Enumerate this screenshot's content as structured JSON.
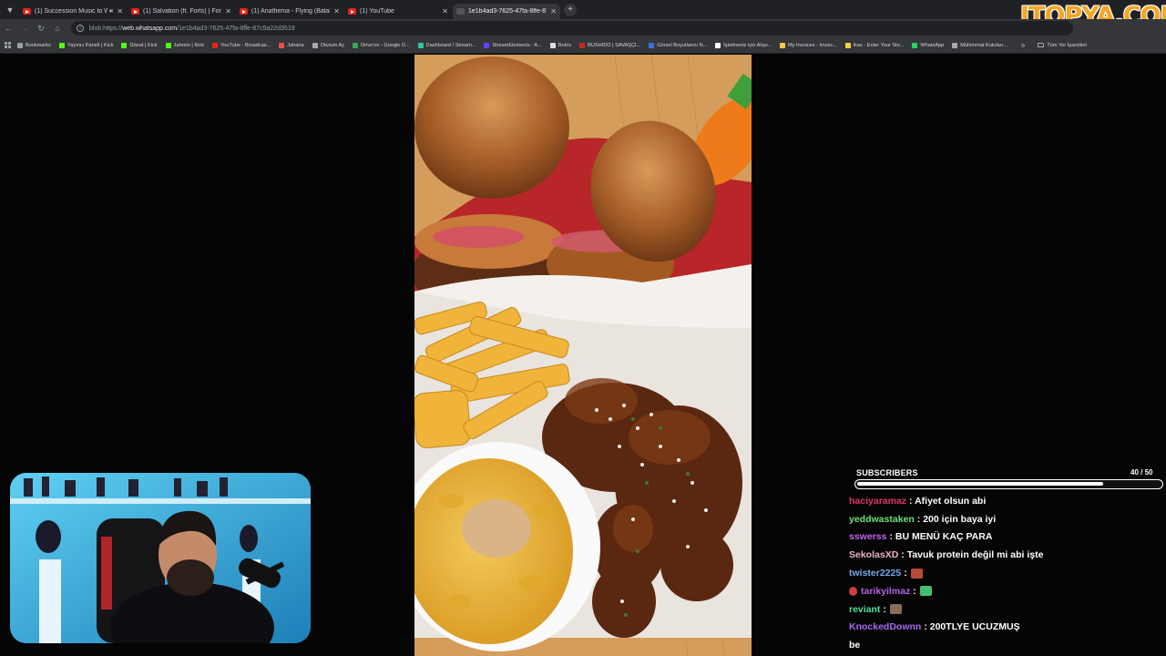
{
  "browser": {
    "tabs": [
      {
        "title": "(1) Succession Music to W",
        "favicon": "youtube-icon",
        "playing": true,
        "active": false
      },
      {
        "title": "(1) Salvation (ft. Forts) | For De",
        "favicon": "youtube-icon",
        "playing": false,
        "active": false
      },
      {
        "title": "(1) Anathema - Flying (Balaban",
        "favicon": "youtube-icon",
        "playing": false,
        "active": false
      },
      {
        "title": "(1) YouTube",
        "favicon": "youtube-icon",
        "playing": false,
        "active": false
      },
      {
        "title": "1e1b4ad3-7625-47fa-8ffe-87c5",
        "favicon": "blank-page-icon",
        "playing": false,
        "active": true
      }
    ],
    "new_tab_label": "+",
    "address": {
      "prefix": "blob:https://",
      "host": "web.whatsapp.com",
      "path": "/1e1b4ad3-7625-47fa-8ffe-87c5a22d3519"
    },
    "bookmarks": [
      {
        "label": "Bookmarks",
        "icon": "star-icon",
        "color": "#9aa0a6"
      },
      {
        "label": "Yayıncı Paneli | Kick",
        "icon": "kick-icon",
        "color": "#53fc18"
      },
      {
        "label": "Gözat | Kick",
        "icon": "kick-icon",
        "color": "#53fc18"
      },
      {
        "label": "Jahrein | Kick",
        "icon": "kick-icon",
        "color": "#53fc18"
      },
      {
        "label": "YouTube - Broadcas...",
        "icon": "youtube-icon",
        "color": "#e62117"
      },
      {
        "label": "Jaharia",
        "icon": "site-icon",
        "color": "#e0524c"
      },
      {
        "label": "Oturum Aç",
        "icon": "site-icon",
        "color": "#aaaaaa"
      },
      {
        "label": "Drive'ım - Google D...",
        "icon": "drive-icon",
        "color": "#34a853"
      },
      {
        "label": "Dashboard / Stream...",
        "icon": "site-icon",
        "color": "#31c3a2"
      },
      {
        "label": "StreamElements - A...",
        "icon": "site-icon",
        "color": "#6441ff"
      },
      {
        "label": "Botrix",
        "icon": "site-icon",
        "color": "#dddddd"
      },
      {
        "label": "BUSHIDO | SAVAŞÇI...",
        "icon": "site-icon",
        "color": "#c62828"
      },
      {
        "label": "Görsel Boyutlarını N...",
        "icon": "site-icon",
        "color": "#3f6fd8"
      },
      {
        "label": "İşletmeniz için Alışv...",
        "icon": "site-icon",
        "color": "#ffffff"
      },
      {
        "label": "My Invoices - Invoic...",
        "icon": "site-icon",
        "color": "#f7c948"
      },
      {
        "label": "ikas - Enter Your Sto...",
        "icon": "site-icon",
        "color": "#f5d33b"
      },
      {
        "label": "WhatsApp",
        "icon": "whatsapp-icon",
        "color": "#25d366"
      },
      {
        "label": "Mühimmat Kutuları...",
        "icon": "site-icon",
        "color": "#aaaaaa"
      }
    ],
    "bookmarks_more": "»",
    "all_bookmarks": "Tüm Yer İşaretleri"
  },
  "logo_text": "ITOPYA.COM",
  "subscribers": {
    "label": "SUBSCRIBERS",
    "count_text": "40 / 50",
    "progress": 0.8
  },
  "chat": [
    {
      "user": "haciyaramaz",
      "color": "#e0336a",
      "text": ": Afiyet olsun abi"
    },
    {
      "user": "yeddwastaken",
      "color": "#6ee07a",
      "text": ": 200 için baya iyi"
    },
    {
      "user": "sswerss",
      "color": "#c45ee8",
      "text": ": BU MENÜ KAÇ PARA"
    },
    {
      "user": "SekolasXD",
      "color": "#f0b0cc",
      "text": ": Tavuk protein değil mi abi işte"
    },
    {
      "user": "twister2225",
      "color": "#78a8e8",
      "text": ":",
      "emote": "#b84a3a"
    },
    {
      "user": "tarikyilmaz",
      "color": "#b264e8",
      "text": ":",
      "badge": true,
      "emote": "#45c070"
    },
    {
      "user": "reviant",
      "color": "#4ee0a0",
      "text": ":",
      "emote": "#8a6a5a"
    },
    {
      "user": "KnockedDownn",
      "color": "#a86af0",
      "text": ": 200TLYE UCUZMUŞ"
    },
    {
      "user": "",
      "color": "#ffffff",
      "text": "be"
    }
  ]
}
